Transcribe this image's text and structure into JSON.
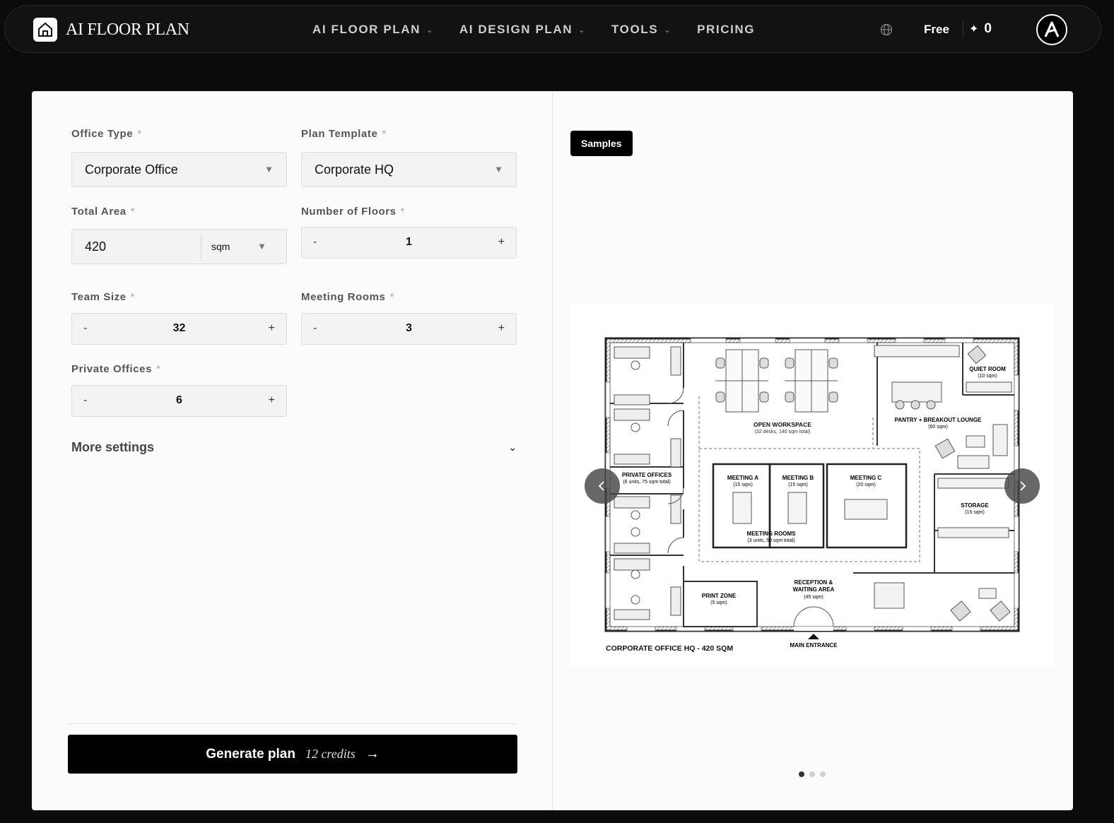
{
  "header": {
    "brand": "AI FLOOR PLAN",
    "menu": [
      {
        "label": "AI FLOOR PLAN",
        "has_dropdown": true
      },
      {
        "label": "AI DESIGN PLAN",
        "has_dropdown": true
      },
      {
        "label": "TOOLS",
        "has_dropdown": true
      },
      {
        "label": "PRICING",
        "has_dropdown": false
      }
    ],
    "plan_badge": "Free",
    "credits": "0",
    "icons": [
      "home-logo-icon",
      "globe-icon",
      "sparkle-icon",
      "avatar-logo-icon"
    ]
  },
  "form": {
    "office_type": {
      "label": "Office Type",
      "required": "*",
      "value": "Corporate Office"
    },
    "plan_template": {
      "label": "Plan Template",
      "required": "*",
      "value": "Corporate HQ"
    },
    "total_area": {
      "label": "Total Area",
      "required": "*",
      "value": "420",
      "unit": "sqm"
    },
    "floors": {
      "label": "Number of Floors",
      "required": "*",
      "value": "1"
    },
    "team_size": {
      "label": "Team Size",
      "required": "*",
      "value": "32"
    },
    "meeting_rooms": {
      "label": "Meeting Rooms",
      "required": "*",
      "value": "3"
    },
    "private_offices": {
      "label": "Private Offices",
      "required": "*",
      "value": "6"
    },
    "stepper_minus": "-",
    "stepper_plus": "+",
    "more_settings": "More settings",
    "generate": {
      "label": "Generate plan",
      "credits": "12 credits",
      "arrow": "→"
    }
  },
  "preview": {
    "samples_button": "Samples",
    "current_slide": 1,
    "total_slides": 3,
    "plan": {
      "open_workspace": "OPEN WORKSPACE",
      "open_workspace_sub": "(32 desks, 140 sqm total)",
      "pantry": "PANTRY + BREAKOUT LOUNGE",
      "pantry_sub": "(60 sqm)",
      "quiet_room": "QUIET ROOM",
      "quiet_room_sub": "(10 sqm)",
      "private_offices": "PRIVATE OFFICES",
      "private_offices_sub": "(6 units, 75 sqm total)",
      "meeting_a": "MEETING A",
      "meeting_a_sub": "(15 sqm)",
      "meeting_b": "MEETING B",
      "meeting_b_sub": "(15 sqm)",
      "meeting_c": "MEETING C",
      "meeting_c_sub": "(20 sqm)",
      "meeting_rooms": "MEETING ROOMS",
      "meeting_rooms_sub": "(3 units, 50 sqm total)",
      "storage": "STORAGE",
      "storage_sub": "(15 sqm)",
      "print_zone": "PRINT ZONE",
      "print_zone_sub": "(5 sqm)",
      "reception_1": "RECEPTION &",
      "reception_2": "WAITING AREA",
      "reception_sub": "(45 sqm)",
      "main_entrance": "MAIN ENTRANCE",
      "title": "CORPORATE OFFICE HQ - 420 SQM"
    }
  }
}
